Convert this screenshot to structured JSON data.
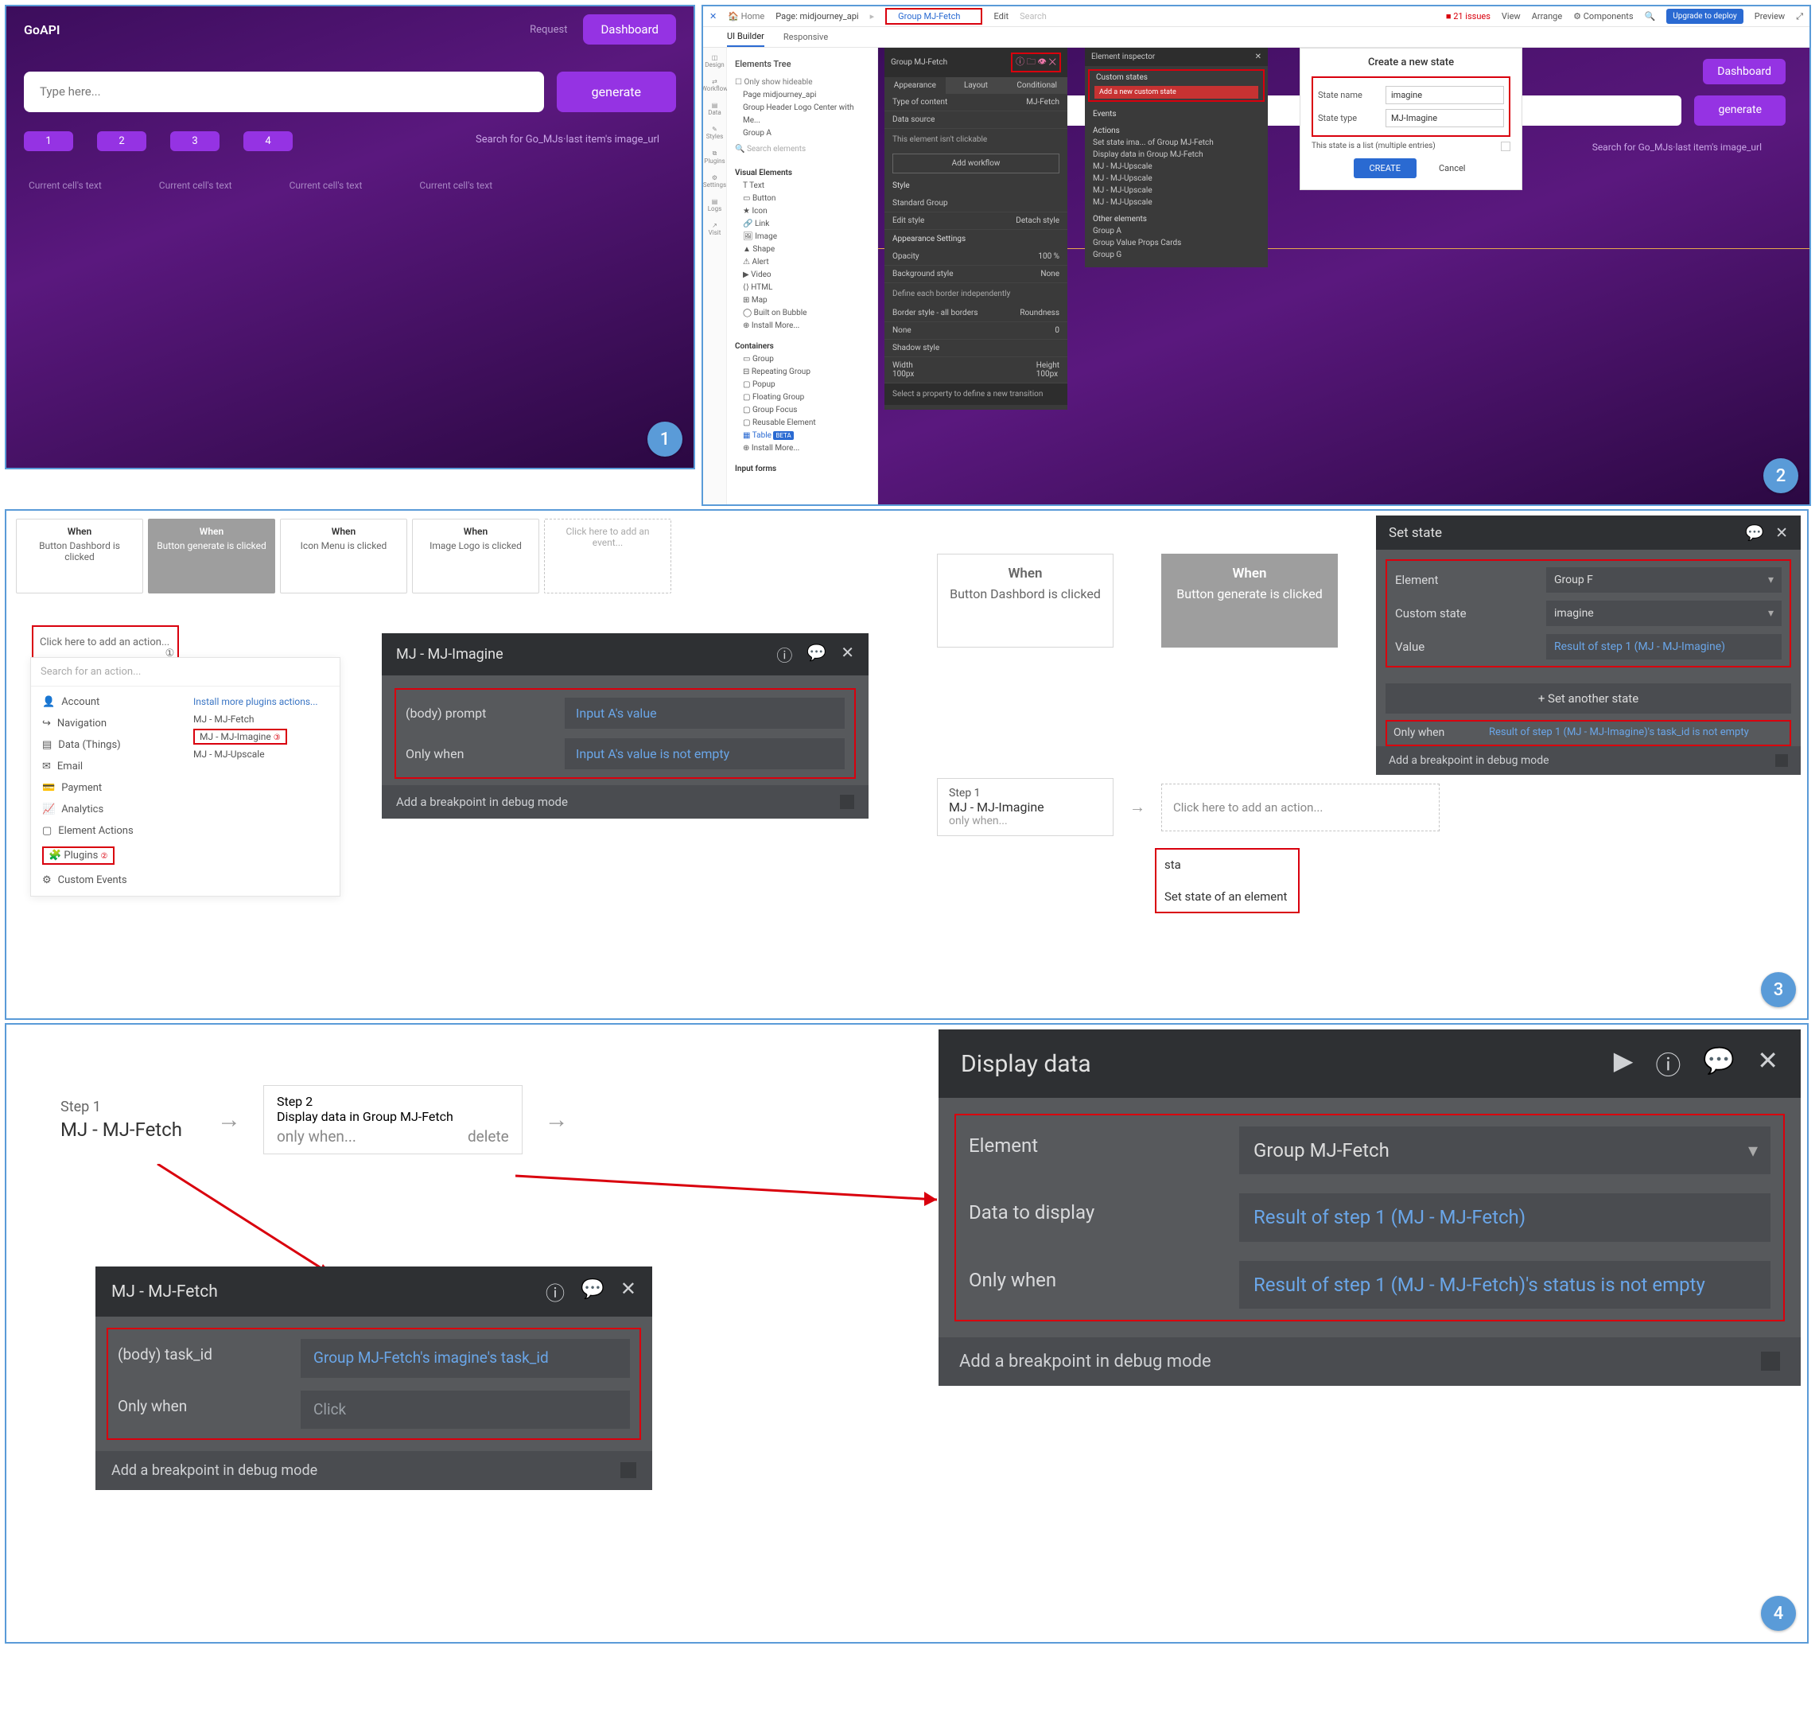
{
  "panel1": {
    "logo": "GoAPI",
    "nav_request": "Request",
    "nav_dashboard": "Dashboard",
    "input_placeholder": "Type here...",
    "generate": "generate",
    "num_buttons": [
      "1",
      "2",
      "3",
      "4"
    ],
    "search_hint": "Search for Go_MJs·last item's image_url",
    "cell_text": "Current cell's text"
  },
  "panel2": {
    "top": {
      "home": "Home",
      "page_label": "Page:",
      "page_name": "midjourney_api",
      "group": "Group MJ-Fetch",
      "edit": "Edit",
      "search_ph": "Search",
      "issues": "■ 21 issues",
      "view": "View",
      "arrange": "Arrange",
      "components": "Components",
      "upgrade": "Upgrade to deploy",
      "preview": "Preview"
    },
    "tabs": {
      "active": "UI Builder",
      "responsive": "Responsive"
    },
    "rail": [
      "Design",
      "Workflow",
      "Data",
      "Styles",
      "Plugins",
      "Settings",
      "Logs",
      "Visit"
    ],
    "tree": {
      "title": "Elements Tree",
      "chk": "Only show hideable",
      "items": [
        "Page midjourney_api",
        "Group Header Logo Center with Me...",
        "Group A"
      ],
      "search": "Search elements",
      "vis_hdr": "Visual Elements",
      "vis": [
        "Text",
        "Button",
        "Icon",
        "Link",
        "Image",
        "Shape",
        "Alert",
        "Video",
        "HTML",
        "Map",
        "Built on Bubble",
        "Install More..."
      ],
      "cont_hdr": "Containers",
      "cont": [
        "Group",
        "Repeating Group",
        "Popup",
        "Floating Group",
        "Group Focus",
        "Reusable Element",
        "Table",
        "Install More..."
      ],
      "input_hdr": "Input forms"
    },
    "canvas": {
      "dashboard": "Dashboard",
      "generate": "generate",
      "hint": "Search for Go_MJs·last item's image_url"
    },
    "prop": {
      "title": "Group MJ-Fetch",
      "tabs": [
        "Appearance",
        "Layout",
        "Conditional"
      ],
      "type": "Type of content",
      "type_v": "MJ-Fetch",
      "ds": "Data source",
      "ds_v": "",
      "note": "This element isn't clickable",
      "wf": "Add workflow",
      "style_hdr": "Style",
      "style_v": "Standard Group",
      "edit_style": "Edit style",
      "detach": "Detach style",
      "app_hdr": "Appearance Settings",
      "opacity": "Opacity",
      "opacity_v": "100 %",
      "bg": "Background style",
      "bg_v": "None",
      "bdef": "Define each border independently",
      "bstyle": "Border style - all borders",
      "round": "Roundness",
      "none": "None",
      "zero": "0",
      "shadow": "Shadow style",
      "w": "Width",
      "w_v": "100px",
      "h": "Height",
      "h_v": "100px",
      "trans": "Select a property to define a new transition"
    },
    "insp": {
      "title": "Element inspector",
      "cs": "Custom states",
      "add": "Add a new custom state",
      "ev": "Events",
      "ac": "Actions",
      "actions": [
        "Set state ima... of Group MJ-Fetch",
        "Display data in Group MJ-Fetch",
        "MJ - MJ-Upscale",
        "MJ - MJ-Upscale",
        "MJ - MJ-Upscale",
        "MJ - MJ-Upscale"
      ],
      "oe": "Other elements",
      "others": [
        "Group A",
        "Group Value Props Cards",
        "Group G"
      ]
    },
    "state": {
      "title": "Create a new state",
      "name_lbl": "State name",
      "name_v": "imagine",
      "type_lbl": "State type",
      "type_v": "MJ-Imagine",
      "list": "This state is a list (multiple entries)",
      "create": "CREATE",
      "cancel": "Cancel"
    }
  },
  "panel3": {
    "wf_cards": [
      {
        "t": "When",
        "d": "Button Dashbord is clicked"
      },
      {
        "t": "When",
        "d": "Button generate is clicked"
      },
      {
        "t": "When",
        "d": "Icon Menu is clicked"
      },
      {
        "t": "When",
        "d": "Image Logo is clicked"
      }
    ],
    "wf_add": "Click here to add an event...",
    "add_action": "Click here to add an action...",
    "action_search": "Search for an action...",
    "action_cats": [
      "Account",
      "Navigation",
      "Data (Things)",
      "Email",
      "Payment",
      "Analytics",
      "Element Actions",
      "Plugins",
      "Custom Events"
    ],
    "action_inst": "Install more plugins actions...",
    "action_items": [
      "MJ - MJ-Fetch",
      "MJ - MJ-Imagine",
      "MJ - MJ-Upscale"
    ],
    "imagine": {
      "title": "MJ - MJ-Imagine",
      "prompt_lbl": "(body) prompt",
      "prompt_v": "Input A's value",
      "only_lbl": "Only when",
      "only_v": "Input A's value is not empty",
      "bp": "Add a breakpoint in debug mode"
    },
    "right_cards": [
      {
        "t": "When",
        "d": "Button Dashbord is clicked"
      },
      {
        "t": "When",
        "d": "Button generate is clicked"
      }
    ],
    "step1": {
      "s": "Step 1",
      "n": "MJ - MJ-Imagine",
      "ow": "only when..."
    },
    "step_add": "Click here to add an action...",
    "sta_typed": "sta",
    "sta_cmd": "Set state of an element",
    "setstate": {
      "title": "Set state",
      "el": "Element",
      "el_v": "Group F",
      "cs": "Custom state",
      "cs_v": "imagine",
      "val": "Value",
      "val_v": "Result of step 1 (MJ - MJ-Imagine)",
      "plus": "+  Set another state",
      "only": "Only when",
      "only_v": "Result of step 1 (MJ - MJ-Imagine)'s task_id is not empty",
      "bp": "Add a breakpoint in debug mode"
    }
  },
  "panel4": {
    "step1": {
      "s": "Step 1",
      "n": "MJ - MJ-Fetch"
    },
    "step2": {
      "s": "Step 2",
      "n": "Display data in Group MJ-Fetch",
      "ow": "only when...",
      "del": "delete"
    },
    "fetch": {
      "title": "MJ - MJ-Fetch",
      "task_lbl": "(body) task_id",
      "task_v": "Group MJ-Fetch's imagine's task_id",
      "only_lbl": "Only when",
      "only_ph": "Click",
      "bp": "Add a breakpoint in debug mode"
    },
    "dd": {
      "title": "Display data",
      "el": "Element",
      "el_v": "Group MJ-Fetch",
      "data": "Data to display",
      "data_v": "Result of step 1 (MJ - MJ-Fetch)",
      "only": "Only when",
      "only_v": "Result of step 1 (MJ - MJ-Fetch)'s status is not empty",
      "bp": "Add a breakpoint in debug mode"
    }
  }
}
